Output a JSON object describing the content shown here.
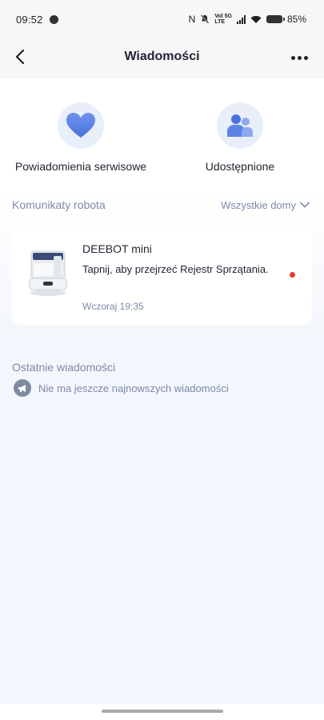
{
  "status_bar": {
    "time": "09:52",
    "battery_percent": "85%",
    "network_top": "Vol 5G",
    "network_bottom": "LTE"
  },
  "header": {
    "title": "Wiadomości",
    "back_icon": "chevron-left-icon",
    "more_icon": "more-dots-icon"
  },
  "categories": [
    {
      "label": "Powiadomienia serwisowe",
      "icon": "heart-icon",
      "color": "#5b84e6"
    },
    {
      "label": "Udostępnione",
      "icon": "users-icon",
      "color": "#5b84e6"
    }
  ],
  "robot_messages": {
    "title": "Komunikaty robota",
    "filter_label": "Wszystkie domy",
    "items": [
      {
        "device": "DEEBOT mini",
        "text": "Tapnij, aby przejrzeć Rejestr Sprzątania.",
        "time": "Wczoraj 19:35",
        "unread": true
      }
    ]
  },
  "recent": {
    "title": "Ostatnie wiadomości",
    "empty_text": "Nie ma jeszcze najnowszych wiadomości"
  },
  "colors": {
    "accent": "#5b84e6",
    "muted_text": "#7d8aa7",
    "unread_dot": "#e23a2f"
  }
}
